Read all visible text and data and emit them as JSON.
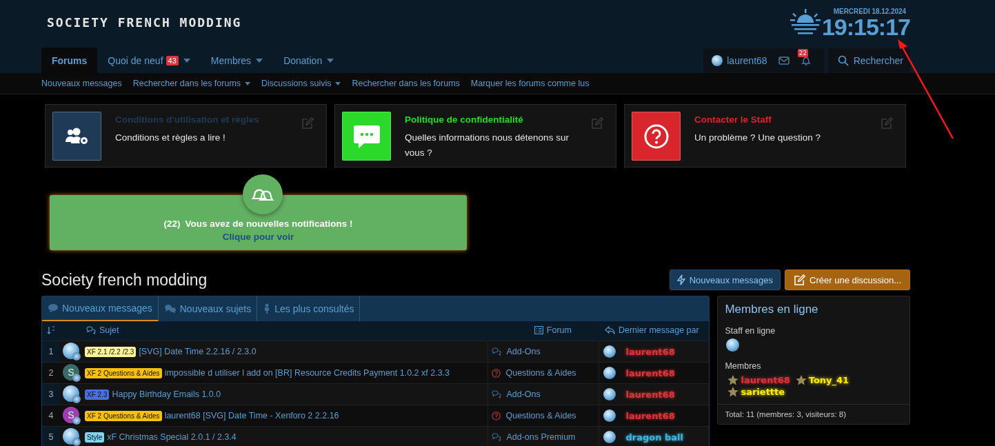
{
  "header": {
    "logo": "SOCIETY FRENCH MODDING",
    "date": "MERCREDI 18.12.2024",
    "time": "19:15:17"
  },
  "nav": {
    "tabs": [
      {
        "label": "Forums",
        "selected": true,
        "dropdown": false
      },
      {
        "label": "Quoi de neuf",
        "selected": false,
        "badge": "43",
        "dropdown": true
      },
      {
        "label": "Membres",
        "selected": false,
        "dropdown": true
      },
      {
        "label": "Donation",
        "selected": false,
        "dropdown": true
      }
    ],
    "user": "laurent68",
    "alerts_badge": "22",
    "search": "Rechercher"
  },
  "subnav": [
    {
      "label": "Nouveaux messages",
      "dropdown": false
    },
    {
      "label": "Rechercher dans les forums",
      "dropdown": true
    },
    {
      "label": "Discussions suivis",
      "dropdown": true
    },
    {
      "label": "Rechercher dans les forums",
      "dropdown": false
    },
    {
      "label": "Marquer les forums comme lus",
      "dropdown": false
    }
  ],
  "notices": [
    {
      "kind": "users",
      "title": "Conditions d'utilisation et règles",
      "text": "Conditions et règles a lire !",
      "color": "#1e3a56"
    },
    {
      "kind": "chat",
      "title": "Politique de confidentialité",
      "text": "Quelles informations nous détenons sur vous ?",
      "color": "#2bd92b"
    },
    {
      "kind": "help",
      "title": "Contacter le Staff",
      "text": "Un problème ? Une question ?",
      "color": "#d9262d"
    }
  ],
  "notification": {
    "count": "(22)",
    "message": "Vous avez de nouvelles notifications !",
    "link": "Clique pour voir"
  },
  "page_title": "Society french modding",
  "actions": [
    {
      "kind": "new",
      "label": "Nouveaux messages"
    },
    {
      "kind": "create",
      "label": "Créer une discussion..."
    }
  ],
  "widget": {
    "tabs": [
      {
        "kind": "chat",
        "label": "Nouveaux messages",
        "selected": true
      },
      {
        "kind": "chats",
        "label": "Nouveaux sujets",
        "selected": false
      },
      {
        "kind": "person",
        "label": "Les plus consultés",
        "selected": false
      }
    ],
    "columns": {
      "subject": "Sujet",
      "forum": "Forum",
      "last": "Dernier message par"
    },
    "rows": [
      {
        "num": "1",
        "avatar": {
          "kind": "smiley"
        },
        "prefix": {
          "label": "XF 2.1 /2.2 /2.3",
          "color": "#fff59a"
        },
        "title": "[SVG] Date Time 2.2.16 / 2.3.0",
        "forum": {
          "kind": "chat",
          "name": "Add-Ons"
        },
        "poster": {
          "name": "laurent68",
          "color": "#e0343a"
        }
      },
      {
        "num": "2",
        "avatar": {
          "kind": "letter",
          "letter": "S",
          "color": "#3c6a66"
        },
        "prefix": {
          "label": "XF 2 Questions & Aides",
          "color": "#ffc107"
        },
        "title": "impossible d utiliser l add on [BR] Resource Credits Payment 1.0.2 xf 2.3.3",
        "forum": {
          "kind": "help",
          "name": "Questions & Aides"
        },
        "poster": {
          "name": "laurent68",
          "color": "#e0343a"
        }
      },
      {
        "num": "3",
        "avatar": {
          "kind": "smiley"
        },
        "prefix": {
          "label": "XF 2.3",
          "color": "#4a6fe0"
        },
        "title": "Happy Birthday Emails 1.0.0",
        "forum": {
          "kind": "chat",
          "name": "Add-Ons"
        },
        "poster": {
          "name": "laurent68",
          "color": "#e0343a"
        }
      },
      {
        "num": "4",
        "avatar": {
          "kind": "letter",
          "letter": "S",
          "color": "#a03cb0"
        },
        "prefix": {
          "label": "XF 2 Questions & Aides",
          "color": "#ffc107"
        },
        "title": "laurent68 [SVG] Date Time - Xenforo 2 2.2.16",
        "forum": {
          "kind": "help",
          "name": "Questions & Aides"
        },
        "poster": {
          "name": "laurent68",
          "color": "#e0343a"
        }
      },
      {
        "num": "5",
        "avatar": {
          "kind": "smiley"
        },
        "prefix": {
          "label": "Style",
          "color": "#7fd3f0"
        },
        "title": "xF Christmas Special 2.0.1 / 2.3.4",
        "forum": {
          "kind": "chat",
          "name": "Add-ons Premium"
        },
        "poster": {
          "name": "dragon ball",
          "color": "#3fb5e0"
        }
      }
    ]
  },
  "online": {
    "title": "Membres en ligne",
    "staff_label": "Staff en ligne",
    "members_label": "Membres",
    "members": [
      {
        "name": "laurent68",
        "color": "#e0343a"
      },
      {
        "name": "Tony_41",
        "color": "#ffee00"
      },
      {
        "name": "sariettte",
        "color": "#ffee00"
      }
    ],
    "total": "Total: 11 (membres: 3, visiteurs: 8)"
  }
}
